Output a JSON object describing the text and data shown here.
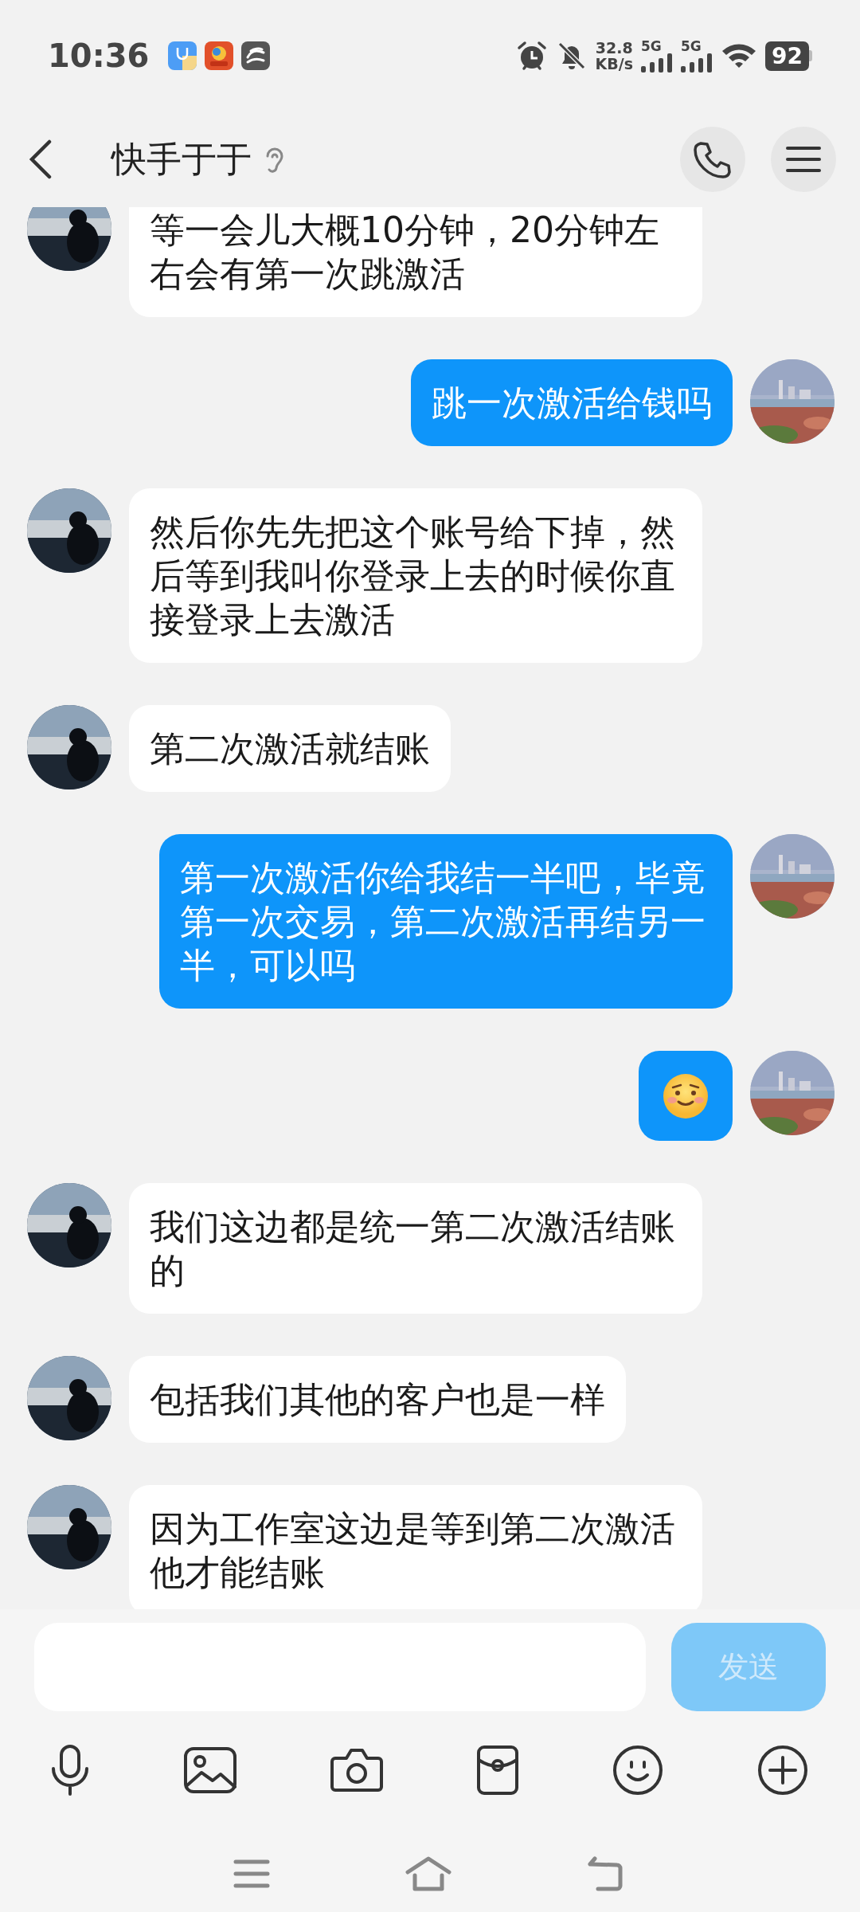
{
  "status_bar": {
    "time": "10:36",
    "speed": "32.8",
    "speed_unit": "KB/s",
    "networks": [
      "5G",
      "5G"
    ],
    "battery": "92"
  },
  "header": {
    "title": "快手于于"
  },
  "messages": [
    {
      "kind": "received",
      "text": "等一会儿大概10分钟，20分钟左右会有第一次跳激活"
    },
    {
      "kind": "sent",
      "text": "跳一次激活给钱吗"
    },
    {
      "kind": "received",
      "text": "然后你先先把这个账号给下掉，然后等到我叫你登录上去的时候你直接登录上去激活"
    },
    {
      "kind": "received",
      "text": "第二次激活就结账"
    },
    {
      "kind": "sent",
      "text": "第一次激活你给我结一半吧，毕竟第一次交易，第二次激活再结另一半，可以吗"
    },
    {
      "kind": "emoji"
    },
    {
      "kind": "received",
      "text": "我们这边都是统一第二次激活结账的"
    },
    {
      "kind": "received",
      "text": "包括我们其他的客户也是一样"
    },
    {
      "kind": "received",
      "text": "因为工作室这边是等到第二次激活他才能结账"
    }
  ],
  "composer": {
    "send": {
      "label": "发送",
      "disabled": true
    }
  }
}
